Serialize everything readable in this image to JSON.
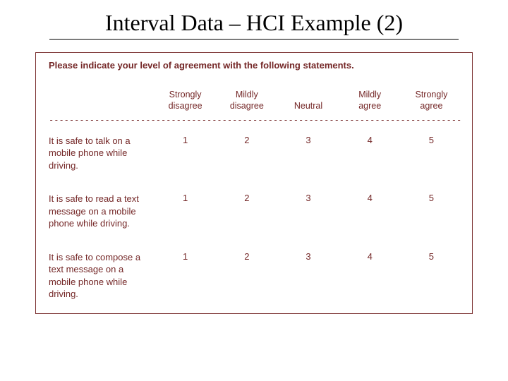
{
  "title": "Interval Data – HCI Example (2)",
  "survey": {
    "prompt": "Please indicate your level of agreement with the following statements.",
    "scale_headers": [
      {
        "line1": "Strongly",
        "line2": "disagree"
      },
      {
        "line1": "Mildly",
        "line2": "disagree"
      },
      {
        "line1": "",
        "line2": "Neutral"
      },
      {
        "line1": "Mildly",
        "line2": "agree"
      },
      {
        "line1": "Strongly",
        "line2": "agree"
      }
    ],
    "questions": [
      {
        "text": "It is safe to talk on a mobile phone while driving.",
        "values": [
          1,
          2,
          3,
          4,
          5
        ]
      },
      {
        "text": "It is safe to read a text message on a mobile phone while driving.",
        "values": [
          1,
          2,
          3,
          4,
          5
        ]
      },
      {
        "text": "It is safe to compose a text message on a mobile phone while driving.",
        "values": [
          1,
          2,
          3,
          4,
          5
        ]
      }
    ],
    "dashes": "----------------------------------------------------------------------------------------------------"
  }
}
